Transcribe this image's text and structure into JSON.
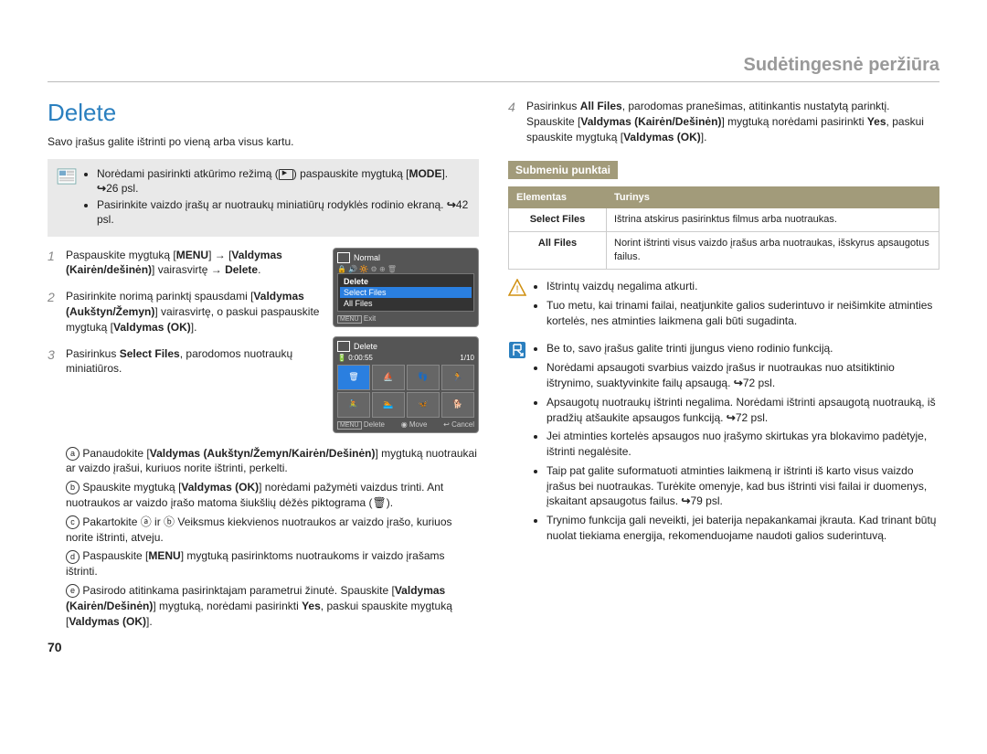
{
  "header": "Sudėtingesnė peržiūra",
  "page_num": "70",
  "title": "Delete",
  "intro": "Savo įrašus galite ištrinti po vieną arba visus kartu.",
  "notebox": {
    "items": [
      {
        "pre": "Norėdami pasirinkti atkūrimo režimą (",
        "post": ") paspauskite mygtuką [",
        "b": "MODE",
        "tail": "]. ",
        "ref": "26 psl."
      },
      {
        "pre": "Pasirinkite vaizdo įrašų ar nuotraukų miniatiūrų rodyklės rodinio ekraną. ",
        "ref": "42 psl."
      }
    ]
  },
  "screens": {
    "s1": {
      "normal": "Normal",
      "title": "Delete",
      "sel": "Select Files",
      "all": "All Files",
      "exit": "Exit"
    },
    "s2": {
      "title": "Delete",
      "time": "0:00:55",
      "count": "1/10",
      "del": "Delete",
      "move": "Move",
      "cancel": "Cancel"
    }
  },
  "steps": {
    "s1": {
      "a": "Paspauskite mygtuką [",
      "b": "MENU",
      "c": "] ",
      "d": " [",
      "e": "Valdymas (Kairėn/dešinėn)",
      "f": "] vairasvirtę ",
      " g": " ",
      "h": "Delete",
      "i": "."
    },
    "s2": {
      "a": "Pasirinkite norimą parinktį spausdami [",
      "b": "Valdymas (Aukštyn/Žemyn)",
      "c": "] vairasvirtę, o paskui paspauskite mygtuką [",
      "d": "Valdymas (OK)",
      "e": "]."
    },
    "s3": {
      "a": "Pasirinkus ",
      "b": "Select Files",
      "c": ", parodomos nuotraukų miniatiūros."
    },
    "substeps": {
      "a": {
        "a": "Panaudokite [",
        "b": "Valdymas (Aukštyn/Žemyn/Kairėn/Dešinėn)",
        "c": "] mygtuką nuotraukai ar vaizdo įrašui, kuriuos norite ištrinti, perkelti."
      },
      "b": {
        "a": "Spauskite mygtuką [",
        "b": "Valdymas (OK)",
        "c": "] norėdami pažymėti vaizdus trinti. Ant nuotraukos ar vaizdo įrašo matoma šiukšlių dėžės piktograma (🗑)."
      },
      "c": {
        "a": "Pakartokite ⓐ ir ⓑ Veiksmus kiekvienos nuotraukos ar vaizdo įrašo, kuriuos norite ištrinti, atveju."
      },
      "d": {
        "a": "Paspauskite [",
        "b": "MENU",
        "c": "] mygtuką pasirinktoms nuotraukoms ir vaizdo įrašams ištrinti."
      },
      "e": {
        "a": "Pasirodo atitinkama pasirinktajam parametrui žinutė. Spauskite [",
        "b": "Valdymas (Kairėn/Dešinėn)",
        "c": "] mygtuką, norėdami pasirinkti ",
        "d": "Yes",
        "e": ", paskui spauskite mygtuką [",
        "f": "Valdymas (OK)",
        "g": "]."
      }
    },
    "s4": {
      "a": "Pasirinkus ",
      "b": "All Files",
      "c": ", parodomas pranešimas, atitinkantis nustatytą parinktį. Spauskite [",
      "d": "Valdymas (Kairėn/Dešinėn)",
      "e": "] mygtuką norėdami pasirinkti ",
      "f": "Yes",
      "g": ", paskui spauskite mygtuką [",
      "h": "Valdymas (OK)",
      "i": "]."
    }
  },
  "submenu_title": "Submeniu punktai",
  "table": {
    "h1": "Elementas",
    "h2": "Turinys",
    "rows": [
      {
        "k": "Select Files",
        "v": "Ištrina atskirus pasirinktus filmus arba nuotraukas."
      },
      {
        "k": "All Files",
        "v": "Norint ištrinti visus vaizdo įrašus arba nuotraukas, išskyrus apsaugotus failus."
      }
    ]
  },
  "warn": {
    "items": [
      "Ištrintų vaizdų negalima atkurti.",
      "Tuo metu, kai trinami failai, neatjunkite galios suderintuvo ir neišimkite atminties kortelės, nes atminties laikmena gali būti sugadinta."
    ]
  },
  "tips": {
    "items": [
      {
        "t": "Be to, savo įrašus galite trinti įjungus vieno rodinio funkciją."
      },
      {
        "t": "Norėdami apsaugoti svarbius vaizdo įrašus ir nuotraukas nuo atsitiktinio ištrynimo, suaktyvinkite failų apsaugą. ",
        "ref": "72 psl."
      },
      {
        "t": "Apsaugotų nuotraukų ištrinti negalima. Norėdami ištrinti apsaugotą nuotrauką, iš pradžių atšaukite apsaugos funkciją. ",
        "ref": "72 psl."
      },
      {
        "t": "Jei atminties kortelės apsaugos nuo įrašymo skirtukas yra blokavimo padėtyje, ištrinti negalėsite."
      },
      {
        "t": "Taip pat galite suformatuoti atminties laikmeną ir ištrinti iš karto visus vaizdo įrašus bei nuotraukas. Turėkite omenyje, kad bus ištrinti visi failai ir duomenys, įskaitant apsaugotus failus. ",
        "ref": "79 psl."
      },
      {
        "t": "Trynimo funkcija gali neveikti, jei baterija nepakankamai įkrauta. Kad trinant būtų nuolat tiekiama energija, rekomenduojame naudoti galios suderintuvą."
      }
    ]
  }
}
